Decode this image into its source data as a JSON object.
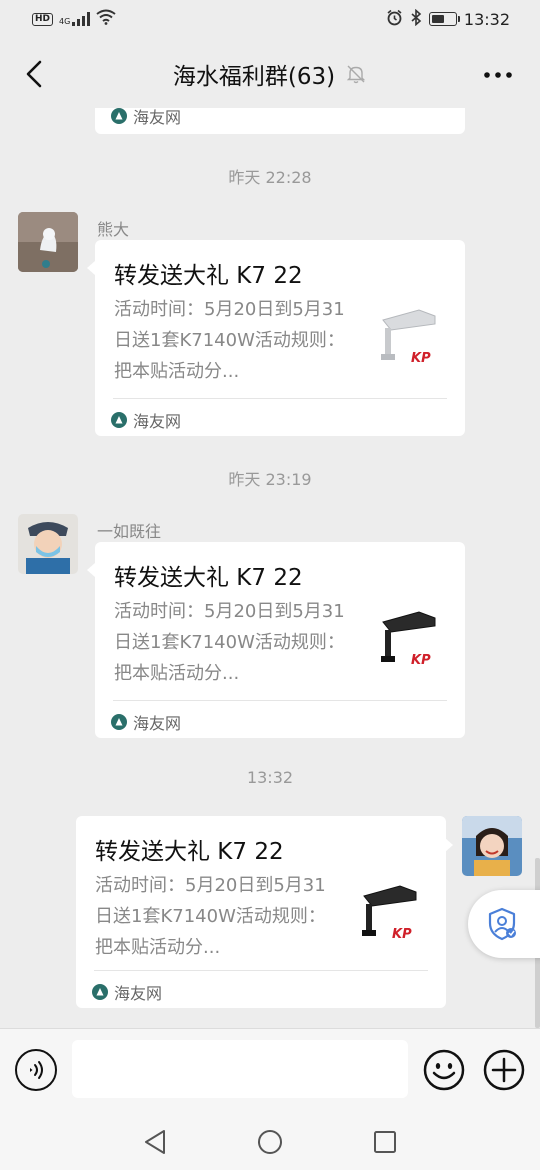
{
  "status_bar": {
    "network_hd": "HD",
    "network_type": "4G",
    "time": "13:32"
  },
  "header": {
    "title": "海水福利群(63)"
  },
  "messages": [
    {
      "sender": "",
      "source": "海友网"
    },
    {
      "timestamp": "昨天 22:28",
      "sender": "熊大",
      "title": "转发送大礼 K7 22",
      "description": "活动时间：5月20日到5月31日送1套K7140W活动规则：把本贴活动分...",
      "source": "海友网",
      "thumb_color": "light-grey"
    },
    {
      "timestamp": "昨天 23:19",
      "sender": "一如既往",
      "title": "转发送大礼 K7 22",
      "description": "活动时间：5月20日到5月31日送1套K7140W活动规则：把本贴活动分...",
      "source": "海友网",
      "thumb_color": "black"
    },
    {
      "timestamp": "13:32",
      "sender": "me",
      "title": "转发送大礼 K7 22",
      "description": "活动时间：5月20日到5月31日送1套K7140W活动规则：把本贴活动分...",
      "source": "海友网",
      "thumb_color": "black"
    }
  ],
  "thumb_logo": "KP",
  "colors": {
    "background": "#ededed",
    "bubble": "#ffffff",
    "source_icon": "#2a6f6a",
    "logo_red": "#d0202a"
  },
  "icons": {
    "back": "chevron-left-icon",
    "mute": "bell-off-icon",
    "more": "more-dots-icon",
    "voice": "voice-icon",
    "emoji": "emoji-icon",
    "plus": "plus-icon",
    "float": "shield-user-icon"
  }
}
